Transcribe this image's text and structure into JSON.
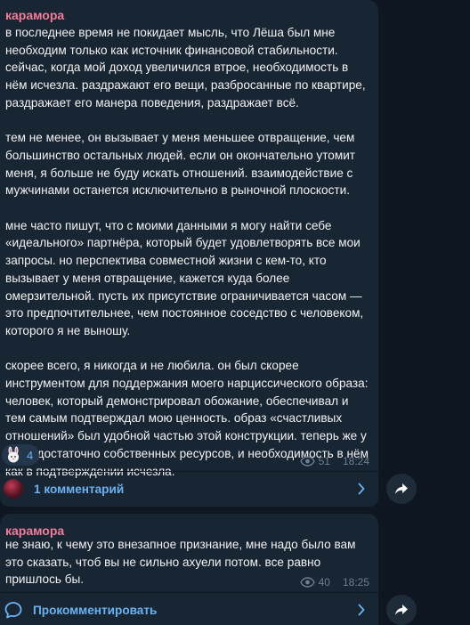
{
  "posts": [
    {
      "author": "карамора",
      "paragraphs": [
        [
          "в последнее время не покидает мысль, что Лёша был мне",
          "необходим только как источник финансовой стабильности.",
          "сейчас, когда мой доход увеличился втрое, необходимость в",
          "нём исчезла. раздражают его вещи, разбросанные по квартире,",
          "раздражает его манера поведения, раздражает всё."
        ],
        [
          "тем не менее, он вызывает у меня меньшее отвращение, чем",
          "большинство остальных людей. если он окончательно утомит",
          "меня, я больше не буду искать отношений. взаимодействие с",
          "мужчинами останется исключительно в рыночной плоскости."
        ],
        [
          "мне часто пишут, что с моими данными я могу найти себе",
          "«идеального» партнёра, который будет удовлетворять все мои",
          "запросы. но перспектива совместной жизни с кем-то, кто",
          "вызывает у меня отвращение, кажется куда более",
          "омерзительной. пусть их присутствие ограничивается часом —",
          "это предпочтительнее, чем постоянное соседство с человеком,",
          "которого я не выношу."
        ],
        [
          "скорее всего, я никогда и не любила. он был скорее",
          "инструментом для поддержания моего нарциссического образа:",
          "человек, который демонстрировал обожание, обеспечивал и",
          "тем самым подтверждал мою ценность. образ «счастливых",
          "отношений» был удобной частью этой конструкции. теперь же у",
          "меня достаточно собственных ресурсов, и необходимость в нём",
          "как в подтверждении исчезла."
        ]
      ],
      "reaction_count": "4",
      "views": "51",
      "time": "18:24",
      "comments_label": "1 комментарий"
    },
    {
      "author": "карамора",
      "paragraphs": [
        [
          "не знаю, к чему это внезапное признание, мне надо было вам",
          "это сказать, чтоб вы не сильно ахуели потом. все равно",
          "пришлось бы."
        ]
      ],
      "views": "40",
      "time": "18:25",
      "comments_label": "Прокомментировать"
    }
  ],
  "icons": {
    "views": "eye-icon",
    "reaction": "bunny-sticker-icon",
    "comments": "comment-bubble-icon",
    "chevron": "chevron-right-icon",
    "share": "share-arrow-icon"
  },
  "colors": {
    "background": "#0e1621",
    "bubble": "#182533",
    "author": "#f27c9a",
    "link": "#6ab3f3",
    "meta": "#6d7f8f"
  }
}
